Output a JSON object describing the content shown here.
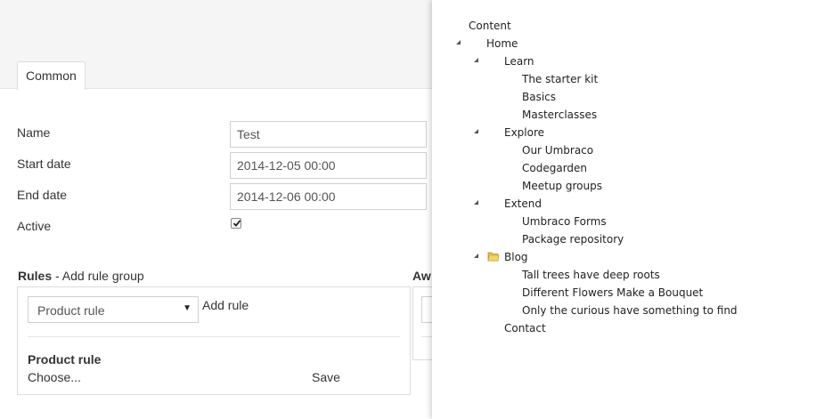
{
  "tabs": [
    {
      "label": "Common"
    }
  ],
  "form": {
    "name_label": "Name",
    "name_value": "Test",
    "start_label": "Start date",
    "start_value": "2014-12-05 00:00",
    "end_label": "End date",
    "end_value": "2014-12-06 00:00",
    "active_label": "Active",
    "active_checked": true
  },
  "rules": {
    "heading_bold": "Rules",
    "heading_rest": " - Add rule group",
    "select_value": "Product rule",
    "add_rule": "Add rule",
    "rule_title": "Product rule",
    "choose": "Choose...",
    "save": "Save"
  },
  "awards": {
    "heading": "Aw"
  },
  "tree": {
    "root": "Content",
    "home": "Home",
    "learn": "Learn",
    "learn_children": [
      "The starter kit",
      "Basics",
      "Masterclasses"
    ],
    "explore": "Explore",
    "explore_children": [
      "Our Umbraco",
      "Codegarden",
      "Meetup groups"
    ],
    "extend": "Extend",
    "extend_children": [
      "Umbraco Forms",
      "Package repository"
    ],
    "blog": "Blog",
    "blog_children": [
      "Tall trees have deep roots",
      "Different Flowers Make a Bouquet",
      "Only the curious have something to find"
    ],
    "contact": "Contact"
  },
  "colors": {
    "folder": "#e8c24a",
    "panel_bg": "#ffffff",
    "topbar_bg": "#f5f5f5"
  }
}
